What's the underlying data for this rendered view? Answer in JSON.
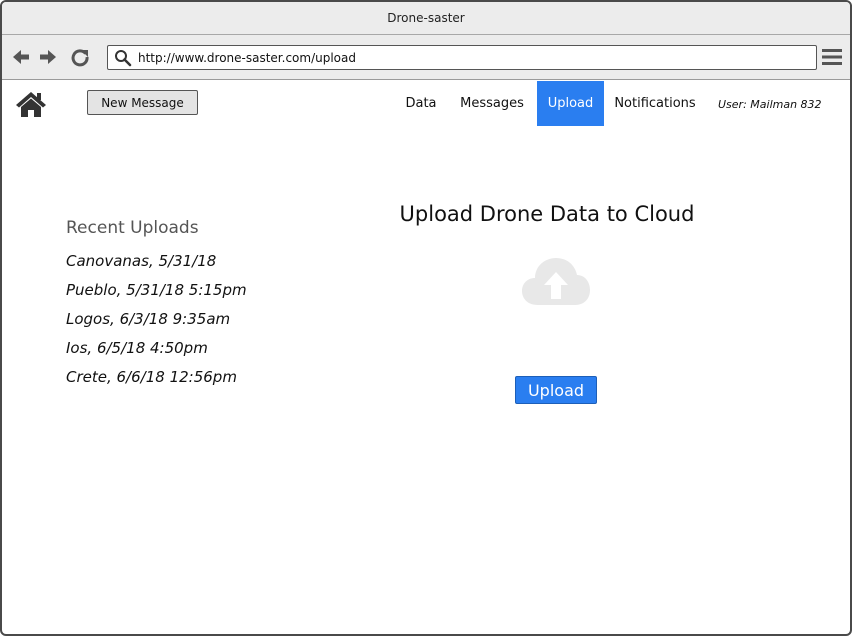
{
  "window": {
    "title": "Drone-saster"
  },
  "browser": {
    "url": "http://www.drone-saster.com/upload",
    "icons": {
      "back": "arrow-left-icon",
      "forward": "arrow-right-icon",
      "reload": "reload-icon",
      "search": "search-icon",
      "menu": "hamburger-menu-icon"
    }
  },
  "header": {
    "home_icon": "home-icon",
    "new_message_label": "New Message",
    "nav": [
      {
        "label": "Data",
        "active": false
      },
      {
        "label": "Messages",
        "active": false
      },
      {
        "label": "Upload",
        "active": true
      },
      {
        "label": "Notifications",
        "active": false
      }
    ],
    "user": "User: Mailman 832"
  },
  "recent": {
    "title": "Recent Uploads",
    "items": [
      "Canovanas, 5/31/18",
      "Pueblo, 5/31/18 5:15pm",
      "Logos, 6/3/18 9:35am",
      "Ios, 6/5/18 4:50pm",
      "Crete, 6/6/18 12:56pm"
    ]
  },
  "main": {
    "title": "Upload Drone Data to Cloud",
    "cloud_icon": "cloud-upload-icon",
    "upload_label": "Upload"
  },
  "colors": {
    "accent": "#2a7ef0",
    "chrome": "#ececec",
    "cloud": "#e8e8e8"
  }
}
